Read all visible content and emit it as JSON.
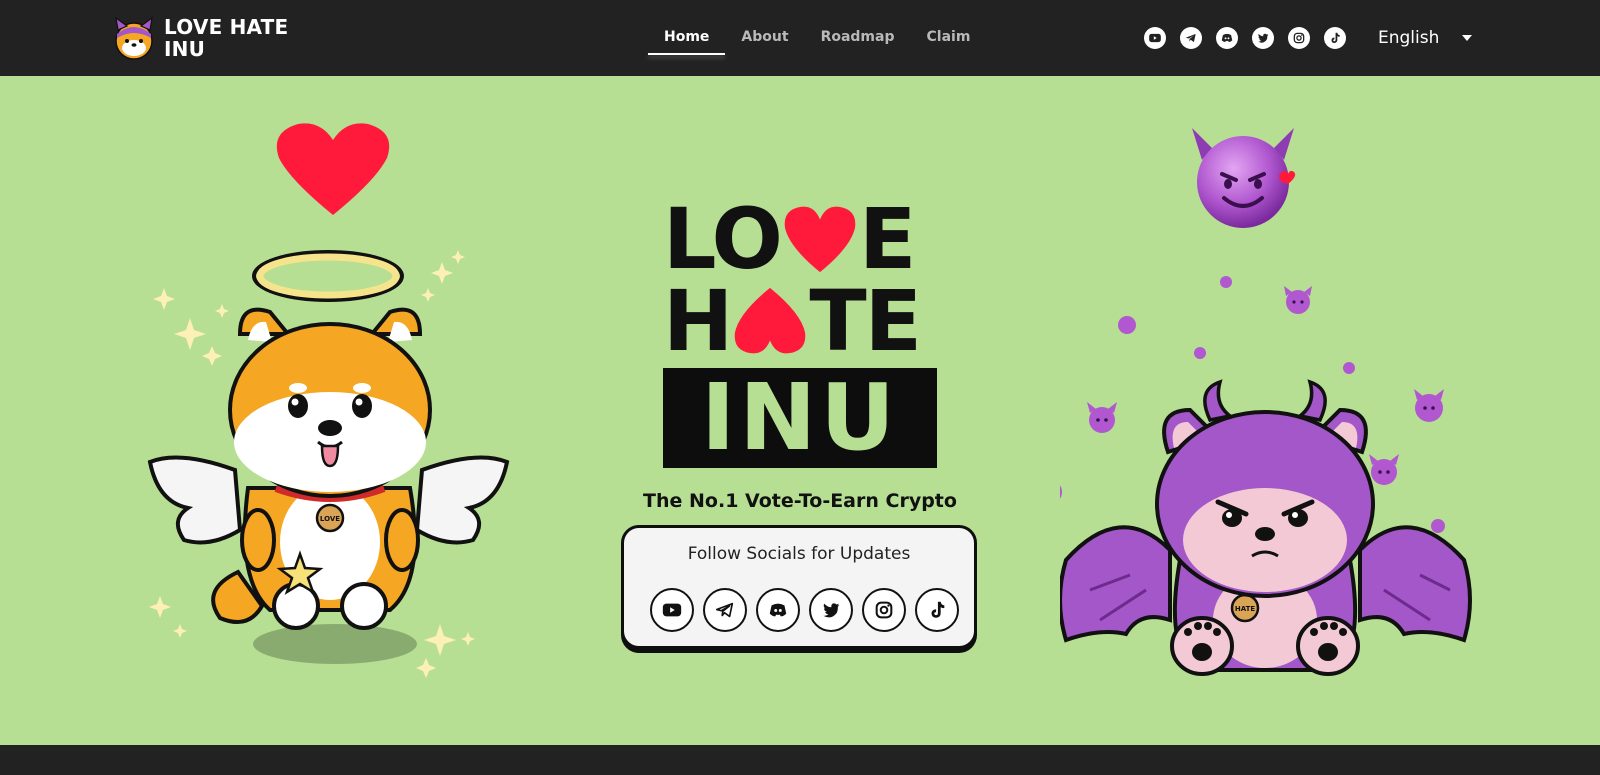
{
  "brand": {
    "name": "LOVE HATE INU",
    "logo_icon": "shiba-devil-logo-icon"
  },
  "nav": {
    "items": [
      {
        "label": "Home",
        "active": true
      },
      {
        "label": "About",
        "active": false
      },
      {
        "label": "Roadmap",
        "active": false
      },
      {
        "label": "Claim",
        "active": false
      }
    ]
  },
  "socials": [
    "youtube-icon",
    "telegram-icon",
    "discord-icon",
    "twitter-icon",
    "instagram-icon",
    "tiktok-icon"
  ],
  "language": {
    "selected": "English"
  },
  "hero": {
    "title_line1": [
      "LO",
      "E"
    ],
    "title_line2": [
      "H",
      "TE"
    ],
    "title_line3": "INU",
    "tagline": "The No.1 Vote-To-Earn Crypto",
    "social_card_title": "Follow Socials for Updates",
    "left_badge": "LOVE",
    "right_badge": "HATE"
  },
  "colors": {
    "background": "#b6df94",
    "navbar": "#222222",
    "heart": "#ff1a3b",
    "devil_purple": "#a357c8",
    "shiba_orange": "#f5a623"
  }
}
